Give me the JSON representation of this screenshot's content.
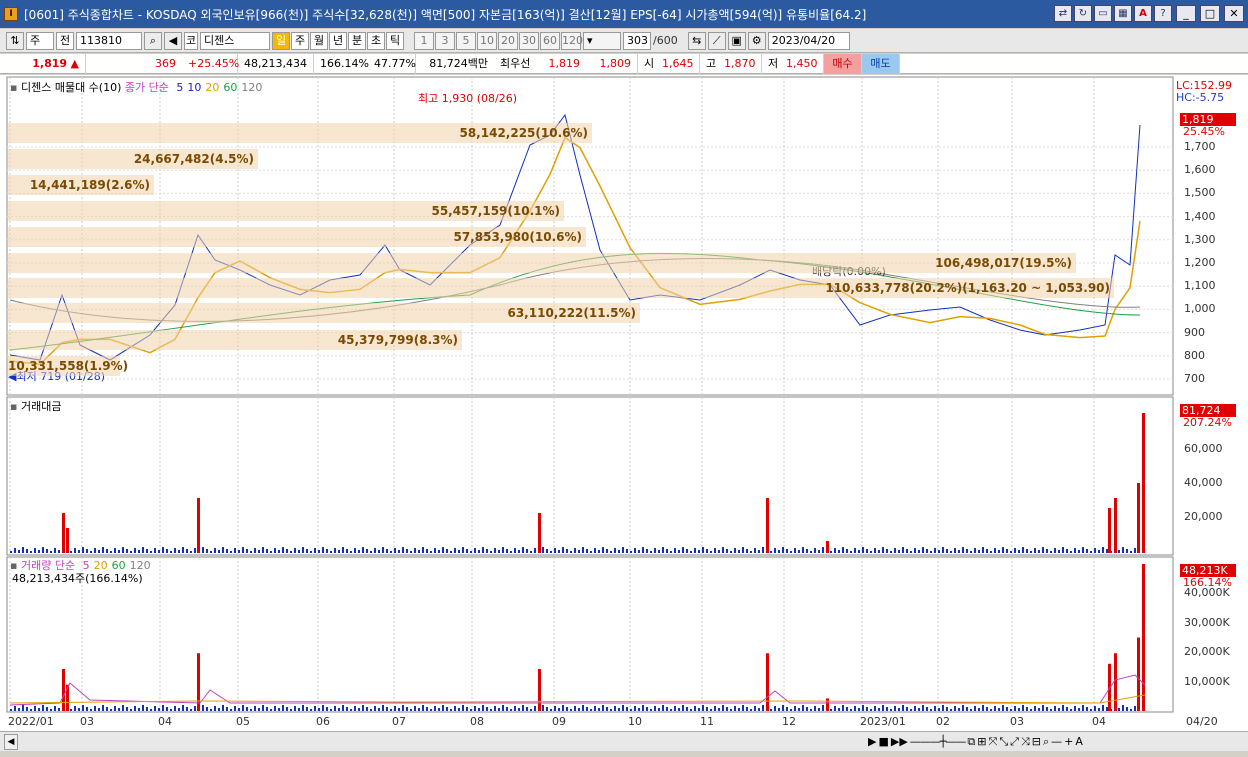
{
  "window": {
    "title": "[0601] 주식종합차트 - KOSDAQ 외국인보유[966(천)] 주식수[32,628(천)] 액면[500] 자본금[163(억)] 결산[12월] EPS[-64] 시가총액[594(억)] 유통비율[64.2]",
    "app_icon": "I"
  },
  "toolbar": {
    "mode": "주",
    "prefix": "전",
    "code": "113810",
    "market": "코",
    "stock_name": "디젠스",
    "period_buttons": [
      "일",
      "주",
      "월",
      "년",
      "분",
      "초",
      "틱"
    ],
    "active_period": "일",
    "interval_buttons": [
      "1",
      "3",
      "5",
      "10",
      "20",
      "30",
      "60",
      "120"
    ],
    "count": "303",
    "count_max": "/600",
    "date": "2023/04/20"
  },
  "quote": {
    "price": "1,819",
    "change_arrow": "▲",
    "change": "369",
    "change_pct": "+25.45%",
    "volume": "48,213,434",
    "volume_ratio": "166.14%",
    "turnover": "47.77%",
    "amount": "81,724백만",
    "best_bid_label": "최우선",
    "best_ask": "1,819",
    "best_bid": "1,809",
    "open_label": "시",
    "open": "1,645",
    "high_label": "고",
    "high": "1,870",
    "low_label": "저",
    "low": "1,450",
    "buy_label": "매수",
    "sell_label": "매도"
  },
  "price_pane": {
    "title": "디젠스 매물대 수(10)",
    "ma_label": "종가 단순",
    "ma_periods": [
      "5",
      "10",
      "20",
      "60",
      "120"
    ],
    "ma_colors": [
      "#2020c0",
      "#2020c0",
      "#e0a000",
      "#20a040",
      "#808080"
    ],
    "lc": "LC:152.99",
    "hc": "HC:-5.75",
    "last_price_tag": "1,819",
    "last_pct_tag": "25.45%",
    "high_annotation": "최고 1,930 (08/26)",
    "low_annotation": "최저 719 (01/28)",
    "ex_rights": "배당락(0.00%)",
    "y_ticks": [
      "1,700",
      "1,600",
      "1,500",
      "1,400",
      "1,300",
      "1,200",
      "1,100",
      "1,000",
      "900",
      "800",
      "700"
    ],
    "volume_profile": [
      {
        "label": "58,142,225(10.6%)"
      },
      {
        "label": "24,667,482(4.5%)"
      },
      {
        "label": "14,441,189(2.6%)"
      },
      {
        "label": "55,457,159(10.1%)"
      },
      {
        "label": "57,853,980(10.6%)"
      },
      {
        "label": "106,498,017(19.5%)"
      },
      {
        "label": "110,633,778(20.2%)(1,163.20 ~ 1,053.90)"
      },
      {
        "label": "63,110,222(11.5%)"
      },
      {
        "label": "45,379,799(8.3%)"
      },
      {
        "label": "10,331,558(1.9%)"
      }
    ]
  },
  "amount_pane": {
    "title": "거래대금",
    "last_tag": "81,724",
    "last_pct": "207.24%",
    "y_ticks": [
      "60,000",
      "40,000",
      "20,000"
    ]
  },
  "volume_pane": {
    "title": "거래량",
    "ma_label": "단순",
    "ma_periods": [
      "5",
      "20",
      "60",
      "120"
    ],
    "summary": "48,213,434주(166.14%)",
    "last_tag": "48,213K",
    "last_pct": "166.14%",
    "y_ticks": [
      "40,000K",
      "30,000K",
      "20,000K",
      "10,000K"
    ]
  },
  "x_axis": [
    "2022/01",
    "03",
    "04",
    "05",
    "06",
    "07",
    "08",
    "09",
    "10",
    "11",
    "12",
    "2023/01",
    "02",
    "03",
    "04"
  ],
  "x_axis_right": "04/20",
  "colors": {
    "up": "#e00000",
    "down": "#1030c0",
    "title_bar": "#2c5aa0"
  }
}
